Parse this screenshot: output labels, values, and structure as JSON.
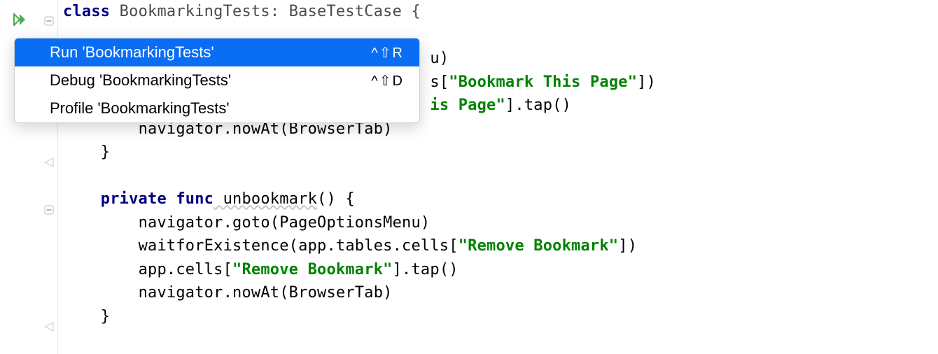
{
  "code": {
    "class_kw": "class",
    "class_name": " BookmarkingTests",
    "colon_base": ": BaseTestCase {",
    "indent2": "        ",
    "indent1": "    ",
    "line2_tail": "u)",
    "line3_prefix": "s[",
    "line3_str": "\"Bookmark This Page\"",
    "line3_suffix": "])",
    "line4_prefix": "is Page\"",
    "line4_suffix": "].tap()",
    "navigator_nowat": "navigator.nowAt(BrowserTab)",
    "close_brace": "}",
    "private_kw": "private",
    "func_kw": " func",
    "unbookmark_name": " unbookmark",
    "unbookmark_sig": "() {",
    "goto_line": "navigator.goto(PageOptionsMenu)",
    "waitfor_prefix": "waitforExistence(app.tables.cells[",
    "remove_bookmark_str": "\"Remove Bookmark\"",
    "waitfor_suffix": "])",
    "appcells_prefix": "app.cells[",
    "appcells_suffix": "].tap()"
  },
  "menu": {
    "run_label": "Run 'BookmarkingTests'",
    "run_shortcut": "^⇧R",
    "debug_label": "Debug 'BookmarkingTests'",
    "debug_shortcut": "^⇧D",
    "profile_label": "Profile 'BookmarkingTests'"
  }
}
